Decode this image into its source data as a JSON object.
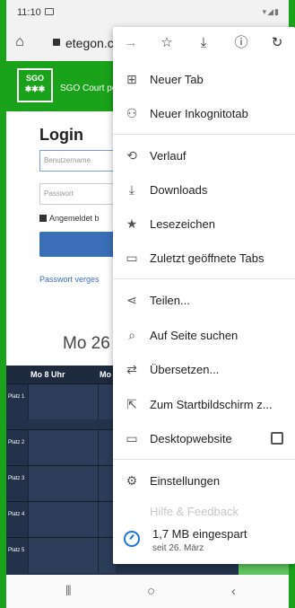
{
  "status_bar": {
    "time": "11:10"
  },
  "browser": {
    "url": "etegon.c"
  },
  "site": {
    "logo_text": "SGO",
    "title": "SGO Court po"
  },
  "login": {
    "title": "Login",
    "username_placeholder": "Benutzername",
    "password_placeholder": "Passwort",
    "remember_label": "Angemeldet b",
    "forgot_link": "Passwort verges",
    "date_label": "Mo 26"
  },
  "schedule": {
    "columns": [
      "Mo 8 Uhr",
      "Mo"
    ],
    "rows": [
      "Platz 1",
      "Platz 2",
      "Platz 3",
      "Platz 4",
      "Platz 5"
    ]
  },
  "menu": {
    "top_icons": [
      "forward-icon",
      "star-icon",
      "download-icon",
      "info-icon",
      "refresh-icon"
    ],
    "items": [
      {
        "label": "Neuer Tab",
        "icon": "new-tab-icon"
      },
      {
        "label": "Neuer Inkognitotab",
        "icon": "incognito-icon"
      },
      {
        "label": "Verlauf",
        "icon": "history-icon"
      },
      {
        "label": "Downloads",
        "icon": "downloads-icon"
      },
      {
        "label": "Lesezeichen",
        "icon": "bookmarks-icon"
      },
      {
        "label": "Zuletzt geöffnete Tabs",
        "icon": "recent-tabs-icon"
      },
      {
        "label": "Teilen...",
        "icon": "share-icon"
      },
      {
        "label": "Auf Seite suchen",
        "icon": "find-icon"
      },
      {
        "label": "Übersetzen...",
        "icon": "translate-icon"
      },
      {
        "label": "Zum Startbildschirm z...",
        "icon": "add-to-home-icon"
      },
      {
        "label": "Desktopwebsite",
        "icon": "desktop-icon"
      },
      {
        "label": "Einstellungen",
        "icon": "settings-icon"
      }
    ],
    "faded_item": "Hilfe & Feedback",
    "savings": {
      "amount": "1,7 MB eingespart",
      "since": "seit 26. März"
    }
  },
  "colors": {
    "brand_green": "#1aa31a",
    "link_blue": "#3a6fb6",
    "schedule_bg": "#23324a"
  }
}
